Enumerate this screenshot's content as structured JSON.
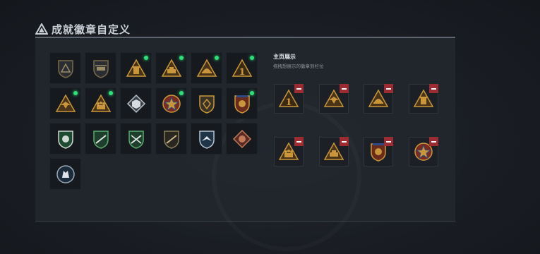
{
  "title": "成就徽章自定义",
  "right": {
    "heading": "主页展示",
    "subheading": "拖拽想展示的徽章到栏位"
  },
  "colors": {
    "gold": "#c9973a",
    "new_dot": "#2ee07a",
    "remove": "#9c2b32"
  },
  "badges": [
    {
      "icon": "triangle-emblem-dark",
      "new": false
    },
    {
      "icon": "helicopter-emblem",
      "new": false
    },
    {
      "icon": "gold-triangle-building",
      "new": true
    },
    {
      "icon": "gold-triangle-vehicle",
      "new": true
    },
    {
      "icon": "gold-triangle-helmet",
      "new": true
    },
    {
      "icon": "gold-triangle-number-1",
      "new": true
    },
    {
      "icon": "gold-triangle-eagle",
      "new": true
    },
    {
      "icon": "gold-triangle-soldiers",
      "new": true
    },
    {
      "icon": "silver-diamond-cube",
      "new": false
    },
    {
      "icon": "gold-star-medal",
      "new": true
    },
    {
      "icon": "gold-shield-emblem",
      "new": false
    },
    {
      "icon": "gold-crest-medal",
      "new": true
    },
    {
      "icon": "green-shield-lion",
      "new": false
    },
    {
      "icon": "green-wreath-rifle",
      "new": false
    },
    {
      "icon": "green-wreath-rifles",
      "new": false
    },
    {
      "icon": "dark-round-rifle",
      "new": false
    },
    {
      "icon": "blue-shield-wing",
      "new": false
    },
    {
      "icon": "red-diamond-crest",
      "new": false
    },
    {
      "icon": "round-wolf-medal",
      "new": false
    }
  ],
  "slots": [
    {
      "icon": "gold-triangle-number-1"
    },
    {
      "icon": "gold-triangle-eagle"
    },
    {
      "icon": "gold-triangle-helmet"
    },
    {
      "icon": "gold-triangle-building"
    },
    {
      "icon": "gold-triangle-soldiers"
    },
    {
      "icon": "gold-triangle-vehicle"
    },
    {
      "icon": "gold-crest-medal"
    },
    {
      "icon": "gold-star-medal"
    }
  ]
}
